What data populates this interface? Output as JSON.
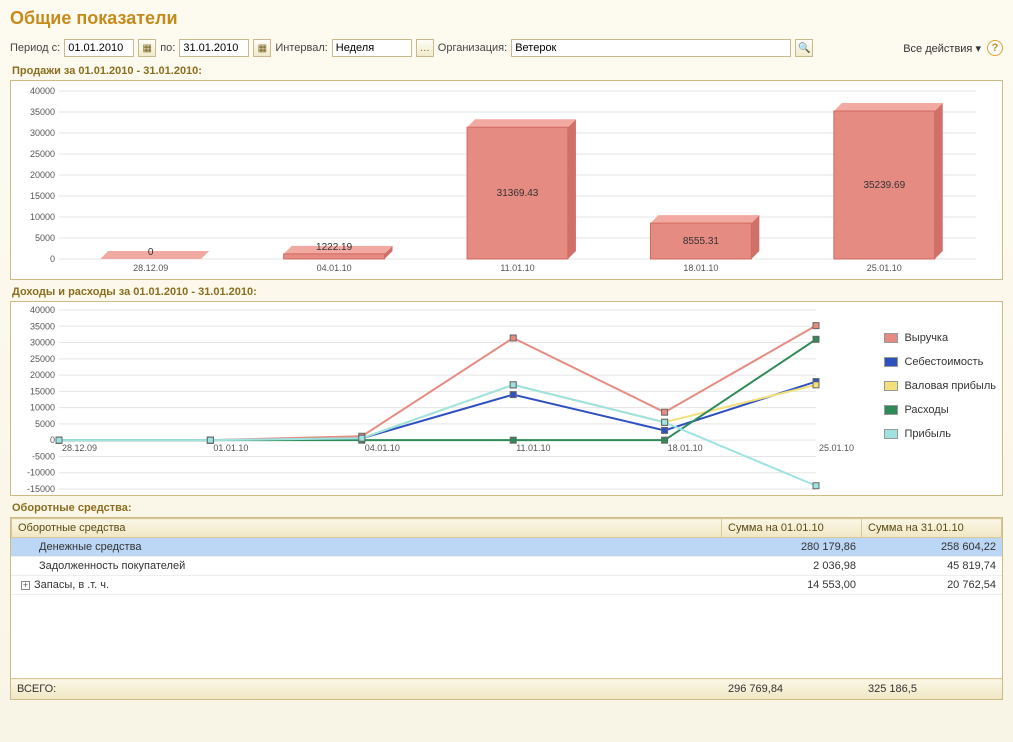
{
  "title": "Общие показатели",
  "toolbar": {
    "period_from_label": "Период с:",
    "period_from": "01.01.2010",
    "period_to_label": "по:",
    "period_to": "31.01.2010",
    "interval_label": "Интервал:",
    "interval": "Неделя",
    "org_label": "Организация:",
    "org": "Ветерок",
    "all_actions": "Все действия"
  },
  "sales_title": "Продажи за 01.01.2010 - 31.01.2010:",
  "incexp_title": "Доходы и расходы за 01.01.2010 - 31.01.2010:",
  "assets_title": "Оборотные средства:",
  "chart_data": [
    {
      "type": "bar",
      "title": "Продажи за 01.01.2010 - 31.01.2010",
      "categories": [
        "28.12.09",
        "04.01.10",
        "11.01.10",
        "18.01.10",
        "25.01.10"
      ],
      "values": [
        0,
        1222.19,
        31369.43,
        8555.31,
        35239.69
      ],
      "ylabel": "",
      "ylim": [
        0,
        40000
      ],
      "ytick_step": 5000
    },
    {
      "type": "line",
      "title": "Доходы и расходы за 01.01.2010 - 31.01.2010",
      "x": [
        "28.12.09",
        "01.01.10",
        "04.01.10",
        "11.01.10",
        "18.01.10",
        "25.01.10"
      ],
      "ylim": [
        -15000,
        40000
      ],
      "ytick_step": 5000,
      "series": [
        {
          "name": "Выручка",
          "color": "#e68b82",
          "values": [
            0,
            0,
            1200,
            31400,
            8600,
            35200
          ]
        },
        {
          "name": "Себестоимость",
          "color": "#3050c0",
          "values": [
            0,
            0,
            600,
            14000,
            3000,
            18000
          ]
        },
        {
          "name": "Валовая прибыль",
          "color": "#f2e07a",
          "values": [
            0,
            0,
            600,
            17000,
            5500,
            17000
          ]
        },
        {
          "name": "Расходы",
          "color": "#2e8b57",
          "values": [
            0,
            0,
            0,
            0,
            0,
            31000
          ]
        },
        {
          "name": "Прибыль",
          "color": "#9fe2e2",
          "values": [
            0,
            0,
            600,
            17000,
            5500,
            -14000
          ]
        }
      ]
    }
  ],
  "table": {
    "headers": [
      "Оборотные средства",
      "Сумма на 01.01.10",
      "Сумма на 31.01.10"
    ],
    "rows": [
      {
        "name": "Денежные средства",
        "v1": "280 179,86",
        "v2": "258 604,22",
        "selected": true,
        "expandable": false
      },
      {
        "name": "Задолженность покупателей",
        "v1": "2 036,98",
        "v2": "45 819,74",
        "selected": false,
        "expandable": false
      },
      {
        "name": "Запасы, в .т. ч.",
        "v1": "14 553,00",
        "v2": "20 762,54",
        "selected": false,
        "expandable": true
      }
    ],
    "footer": {
      "label": "ВСЕГО:",
      "v1": "296 769,84",
      "v2": "325 186,5"
    }
  }
}
